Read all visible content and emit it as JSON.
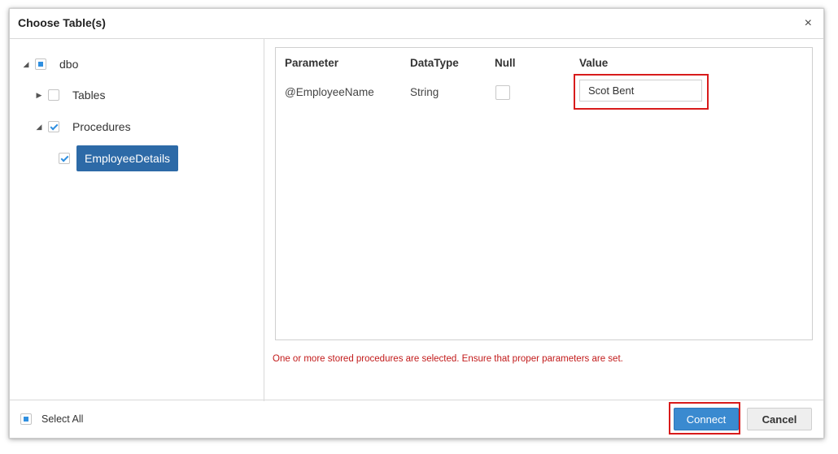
{
  "dialog": {
    "title": "Choose Table(s)",
    "close_glyph": "×"
  },
  "tree": {
    "root": {
      "label": "dbo",
      "state": "partial",
      "expanded": true
    },
    "tables": {
      "label": "Tables",
      "state": "unchecked",
      "expanded": false
    },
    "procedures": {
      "label": "Procedures",
      "state": "checked",
      "expanded": true
    },
    "procedure_item": {
      "label": "EmployeeDetails",
      "state": "checked",
      "selected": true
    }
  },
  "params_table": {
    "headers": [
      "Parameter",
      "DataType",
      "Null",
      "Value"
    ],
    "rows": [
      {
        "parameter": "@EmployeeName",
        "datatype": "String",
        "null": false,
        "value": "Scot Bent"
      }
    ]
  },
  "warning": "One or more stored procedures are selected. Ensure that proper parameters are set.",
  "footer": {
    "select_all_label": "Select All",
    "select_all_state": "partial",
    "connect_label": "Connect",
    "cancel_label": "Cancel"
  },
  "colors": {
    "accent": "#3a8ad0",
    "selected_node": "#2d6aa7",
    "highlight": "#d81b1b",
    "warning": "#c21a1a"
  },
  "icons": {
    "expanded_arrow": "expanded-arrow-icon",
    "collapsed_arrow": "collapsed-arrow-icon"
  }
}
